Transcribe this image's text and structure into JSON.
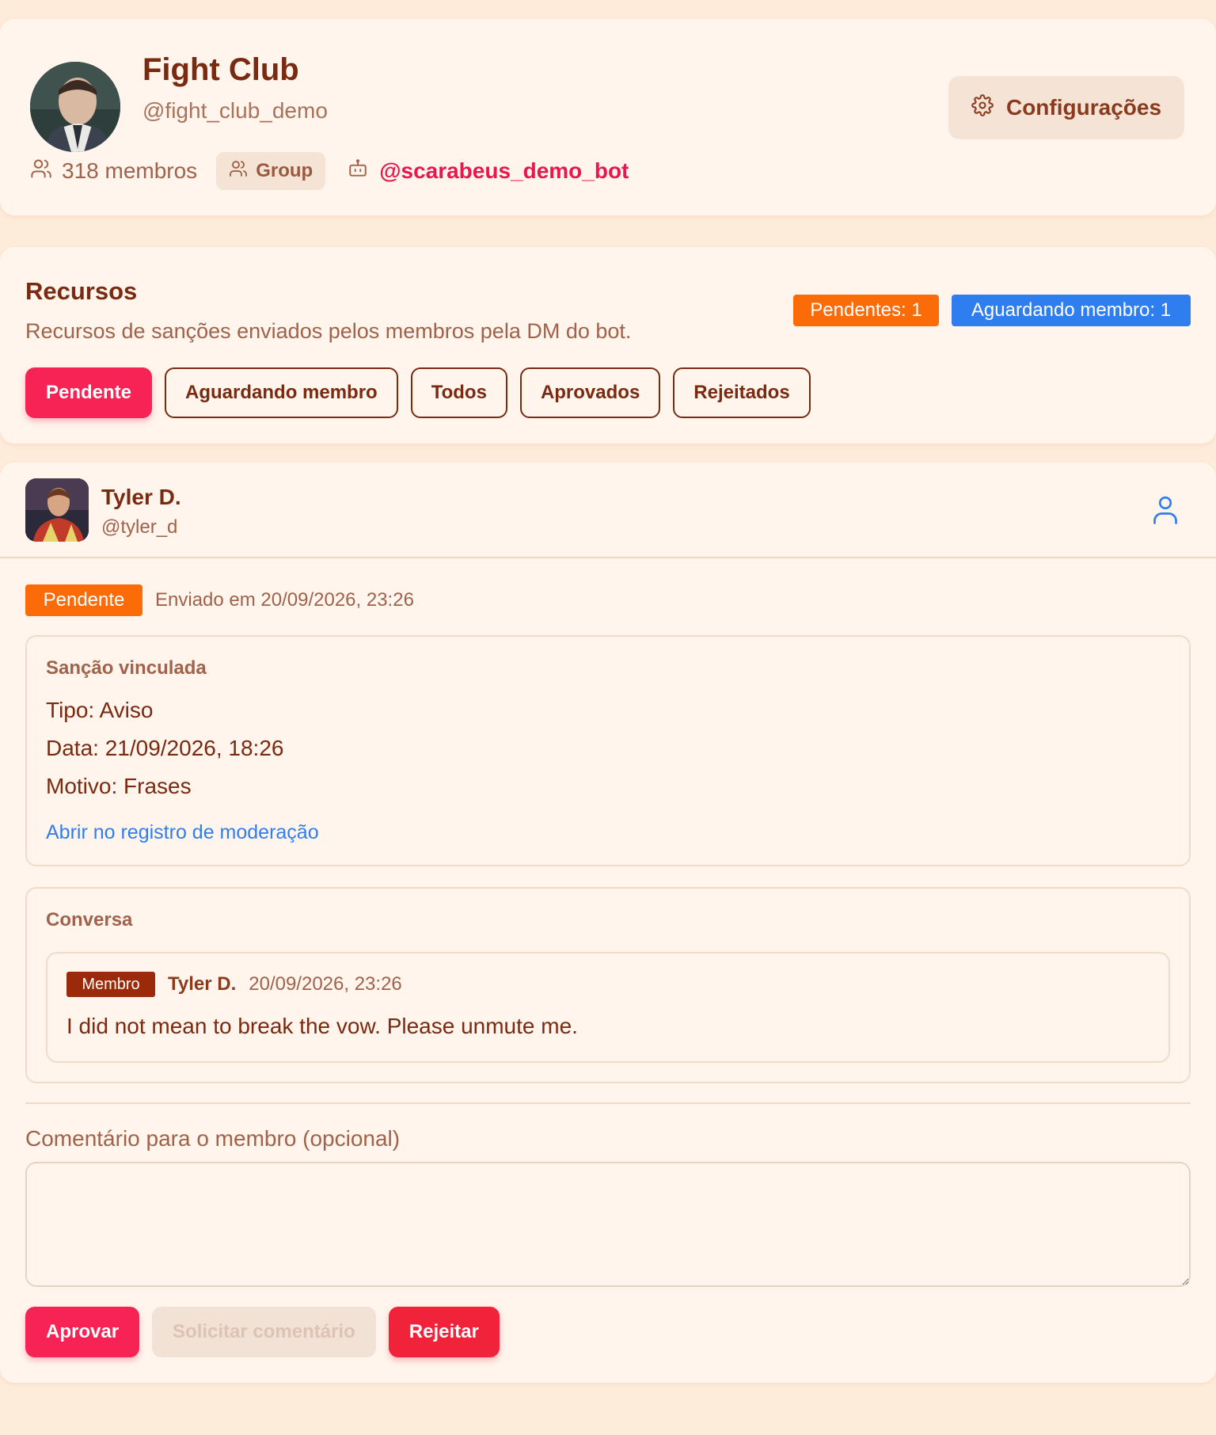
{
  "group": {
    "title": "Fight Club",
    "handle": "@fight_club_demo",
    "members": "318 membros",
    "type_chip": "Group",
    "bot": "@scarabeus_demo_bot",
    "settings_label": "Configurações"
  },
  "recursos": {
    "title": "Recursos",
    "subtitle": "Recursos de sanções enviados pelos membros pela DM do bot.",
    "badge_pending": "Pendentes: 1",
    "badge_awaiting": "Aguardando membro: 1",
    "filters": [
      "Pendente",
      "Aguardando membro",
      "Todos",
      "Aprovados",
      "Rejeitados"
    ],
    "active_filter": "Pendente"
  },
  "appeal": {
    "user_name": "Tyler D.",
    "user_handle": "@tyler_d",
    "status": "Pendente",
    "sent_at": "Enviado em 20/09/2026, 23:26",
    "sanction": {
      "label": "Sanção vinculada",
      "type": "Tipo: Aviso",
      "date": "Data: 21/09/2026, 18:26",
      "reason": "Motivo: Frases",
      "link": "Abrir no registro de moderação"
    },
    "conversation": {
      "label": "Conversa",
      "messages": [
        {
          "role": "Membro",
          "author": "Tyler D.",
          "time": "20/09/2026, 23:26",
          "text": "I did not mean to break the vow. Please unmute me."
        }
      ]
    },
    "comment": {
      "label": "Comentário para o membro (opcional)",
      "value": ""
    },
    "actions": {
      "approve": "Aprovar",
      "request_comment": "Solicitar comentário",
      "reject": "Rejeitar"
    }
  },
  "colors": {
    "accent": "#f72355",
    "orange": "#fb6b08",
    "blue": "#2f7ef0",
    "brown": "#7a2a10",
    "background": "#fdecd9",
    "card": "#fff5ec"
  },
  "icons": {
    "settings": "gear-icon",
    "members": "users-icon",
    "group": "users-icon",
    "bot": "bot-icon",
    "profile": "user-icon"
  }
}
